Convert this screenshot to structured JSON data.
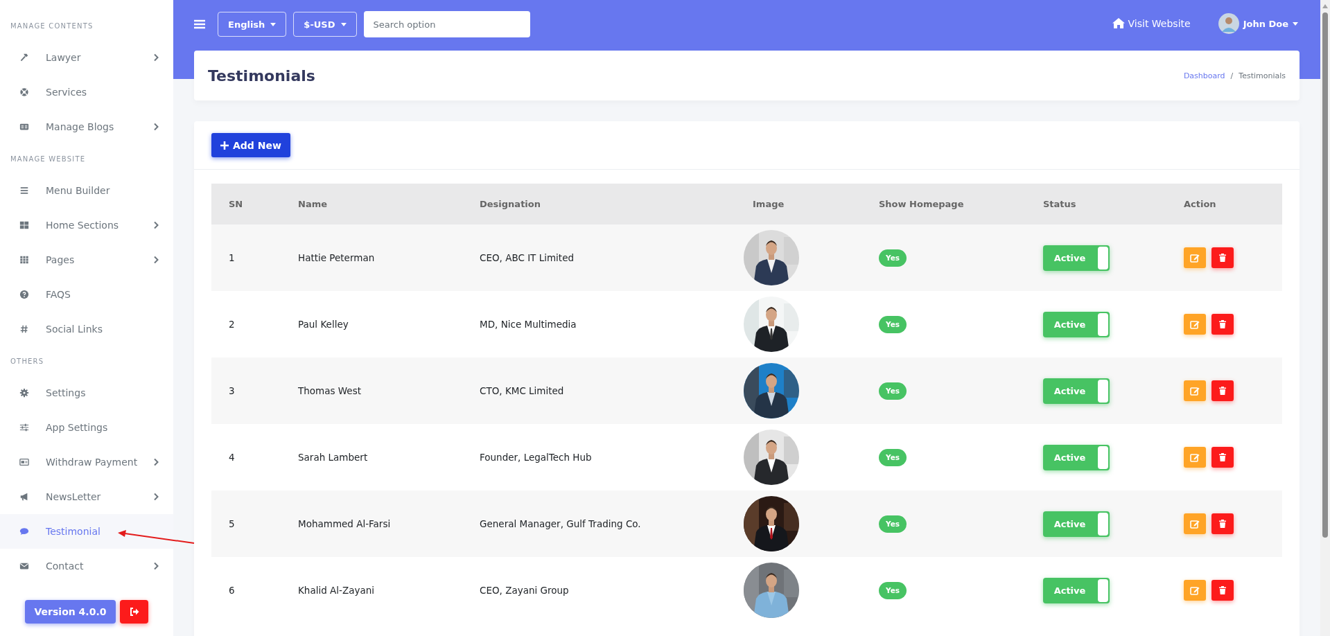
{
  "topbar": {
    "language": "English",
    "currency": "$-USD",
    "search": {
      "placeholder": "Search option"
    },
    "visit_website": "Visit Website",
    "user": "John Doe"
  },
  "sidebar": {
    "sections": [
      {
        "heading": "MANAGE CONTENTS",
        "items": [
          {
            "label": "Lawyer",
            "submenu": true,
            "selected": false
          },
          {
            "label": "Services",
            "submenu": false,
            "selected": false
          },
          {
            "label": "Manage Blogs",
            "submenu": true,
            "selected": false
          }
        ]
      },
      {
        "heading": "MANAGE WEBSITE",
        "items": [
          {
            "label": "Menu Builder",
            "submenu": false,
            "selected": false
          },
          {
            "label": "Home Sections",
            "submenu": true,
            "selected": false
          },
          {
            "label": "Pages",
            "submenu": true,
            "selected": false
          },
          {
            "label": "FAQS",
            "submenu": false,
            "selected": false
          },
          {
            "label": "Social Links",
            "submenu": false,
            "selected": false
          }
        ]
      },
      {
        "heading": "OTHERS",
        "items": [
          {
            "label": "Settings",
            "submenu": false,
            "selected": false
          },
          {
            "label": "App Settings",
            "submenu": false,
            "selected": false
          },
          {
            "label": "Withdraw Payment",
            "submenu": true,
            "selected": false
          },
          {
            "label": "NewsLetter",
            "submenu": true,
            "selected": false
          },
          {
            "label": "Testimonial",
            "submenu": false,
            "selected": true
          },
          {
            "label": "Contact",
            "submenu": true,
            "selected": false
          }
        ]
      }
    ],
    "version": "Version 4.0.0"
  },
  "page": {
    "title": "Testimonials",
    "breadcrumb": [
      "Dashboard",
      "Testimonials"
    ],
    "breadcrumb_separator": "/"
  },
  "add_button": "Add New",
  "table": {
    "columns": [
      "SN",
      "Name",
      "Designation",
      "Image",
      "Show Homepage",
      "Status",
      "Action"
    ],
    "rows": [
      {
        "sn": "1",
        "name": "Hattie Peterman",
        "designation": "CEO, ABC IT Limited",
        "show_homepage": "Yes",
        "status": {
          "label": "Active",
          "on": true
        }
      },
      {
        "sn": "2",
        "name": "Paul Kelley",
        "designation": "MD, Nice Multimedia",
        "show_homepage": "Yes",
        "status": {
          "label": "Active",
          "on": true
        }
      },
      {
        "sn": "3",
        "name": "Thomas West",
        "designation": "CTO, KMC Limited",
        "show_homepage": "Yes",
        "status": {
          "label": "Active",
          "on": true
        }
      },
      {
        "sn": "4",
        "name": "Sarah Lambert",
        "designation": "Founder, LegalTech Hub",
        "show_homepage": "Yes",
        "status": {
          "label": "Active",
          "on": true
        }
      },
      {
        "sn": "5",
        "name": "Mohammed Al-Farsi",
        "designation": "General Manager, Gulf Trading Co.",
        "show_homepage": "Yes",
        "status": {
          "label": "Active",
          "on": true
        }
      },
      {
        "sn": "6",
        "name": "Khalid Al-Zayani",
        "designation": "CEO, Zayani Group",
        "show_homepage": "Yes",
        "status": {
          "label": "Active",
          "on": true
        }
      }
    ]
  }
}
